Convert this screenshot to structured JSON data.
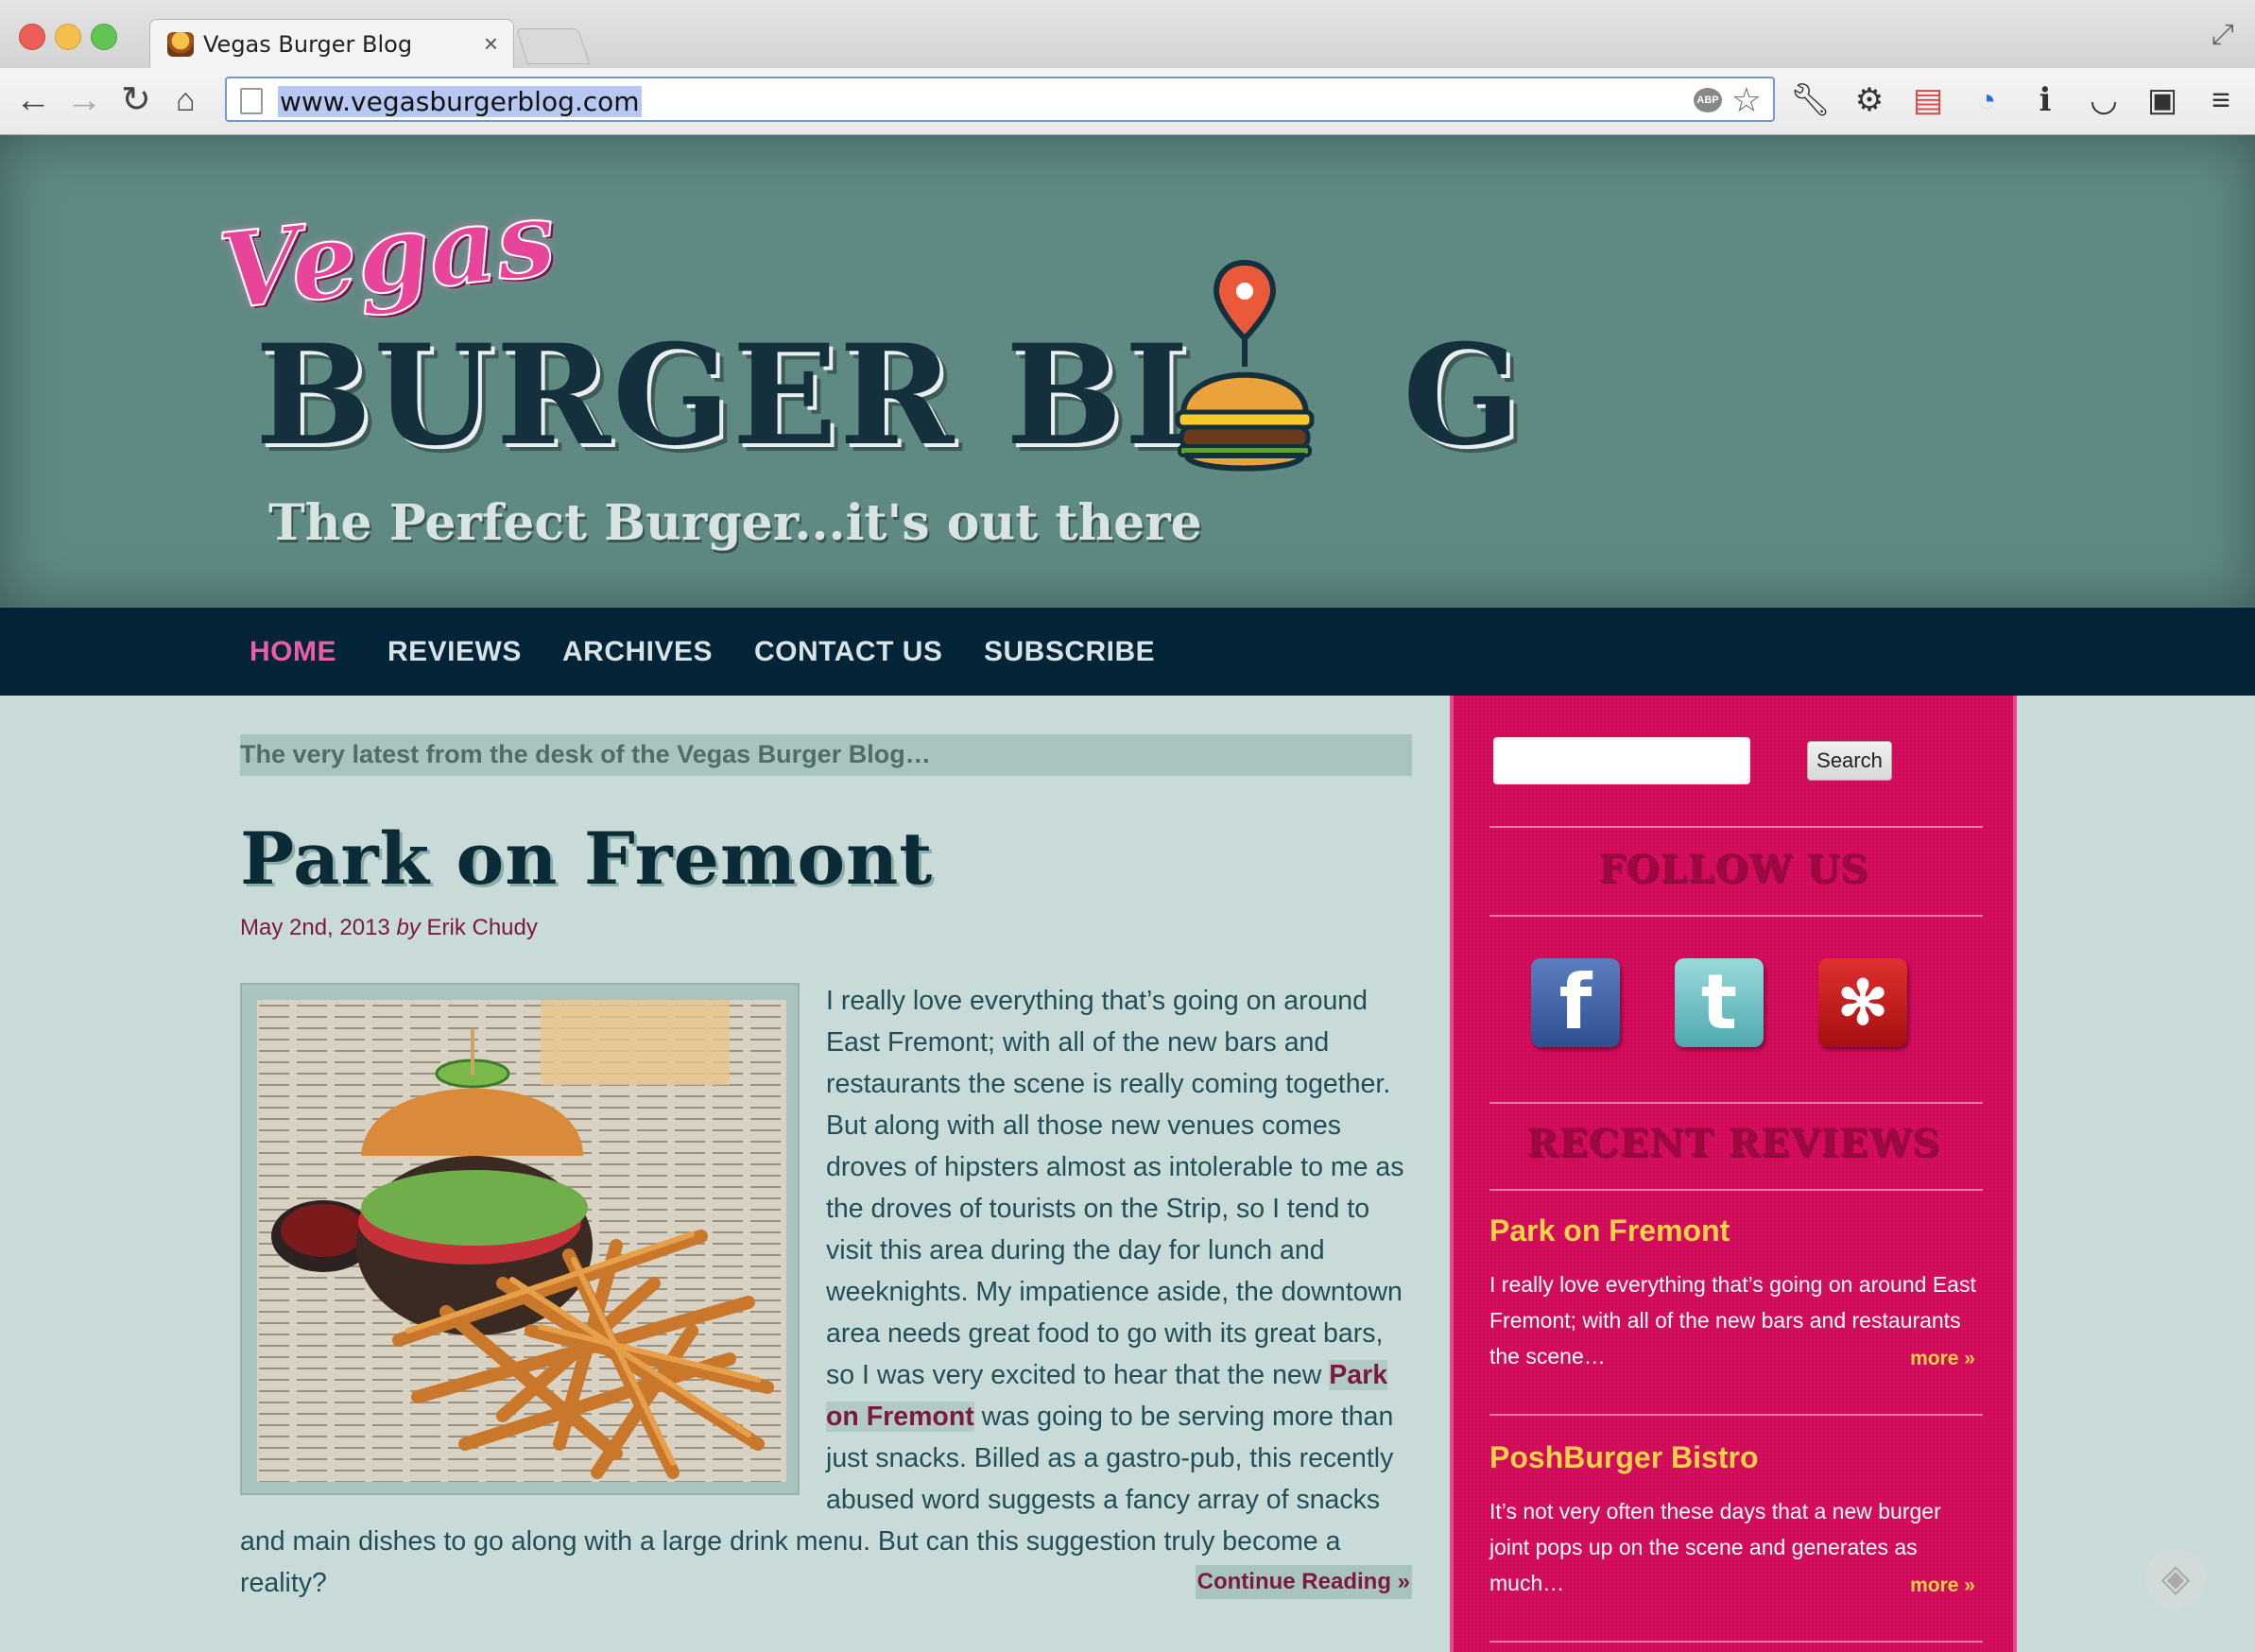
{
  "browser": {
    "tab_title": "Vegas Burger Blog",
    "tab_close": "×",
    "url": "www.vegasburgerblog.com",
    "abp_label": "ABP",
    "icons": [
      "back-arrow-icon",
      "forward-arrow-icon",
      "reload-icon",
      "home-icon",
      "star-icon",
      "wrench-icon",
      "gear-icon",
      "calendar-icon",
      "phone-icon",
      "info-icon",
      "pocket-icon",
      "evernote-icon",
      "menu-icon"
    ]
  },
  "site": {
    "logo_script": "Vegas",
    "logo_main": "BURGER BL",
    "logo_last_letter": "G",
    "tagline": "The Perfect Burger...it's out there",
    "colors": {
      "header_bg": "#5f8a84",
      "nav_bg": "#022436",
      "accent_pink": "#ec5ea4",
      "sidebar_bg": "#d10a5a",
      "link_maroon": "#7a1a3e"
    }
  },
  "nav": {
    "items": [
      {
        "label": "HOME",
        "active": true
      },
      {
        "label": "REVIEWS",
        "active": false
      },
      {
        "label": "ARCHIVES",
        "active": false
      },
      {
        "label": "CONTACT US",
        "active": false
      },
      {
        "label": "SUBSCRIBE",
        "active": false
      }
    ]
  },
  "main": {
    "latest_banner": "The very latest from the desk of the Vegas Burger Blog…",
    "post": {
      "title": "Park on Fremont",
      "date": "May 2nd, 2013",
      "by": "by",
      "author": "Erik Chudy",
      "body_before_link": "I really love everything that’s going on around East Fremont; with all of the new bars and restaurants the scene is really coming together. But along with all those new venues comes droves of hipsters almost as intolerable to me as the droves of tourists on the Strip, so I tend to visit this area during the day for lunch and weeknights. My impatience aside, the downtown area needs great food to go with its great bars, so I was very excited to hear that the new ",
      "body_link": "Park on Fremont",
      "body_after_link": " was going to be serving more than just snacks. Billed as a gastro-pub, this recently abused word suggests a fancy array of snacks and main dishes to go along with a large drink menu. But can this suggestion truly become a reality?",
      "continue_label": "Continue Reading »"
    }
  },
  "sidebar": {
    "search_placeholder": "",
    "search_button": "Search",
    "follow_heading": "FOLLOW US",
    "social": {
      "facebook": "f",
      "twitter": "t",
      "yelp": "✻"
    },
    "recent_heading": "RECENT REVIEWS",
    "reviews": [
      {
        "title": "Park on Fremont",
        "excerpt": "I really love everything that’s going on around East Fremont; with all of the new bars and restaurants the scene…",
        "more": "more »"
      },
      {
        "title": "PoshBurger Bistro",
        "excerpt": "It’s not very often these days that a new burger joint pops up on the scene and generates as much…",
        "more": "more »"
      }
    ]
  }
}
